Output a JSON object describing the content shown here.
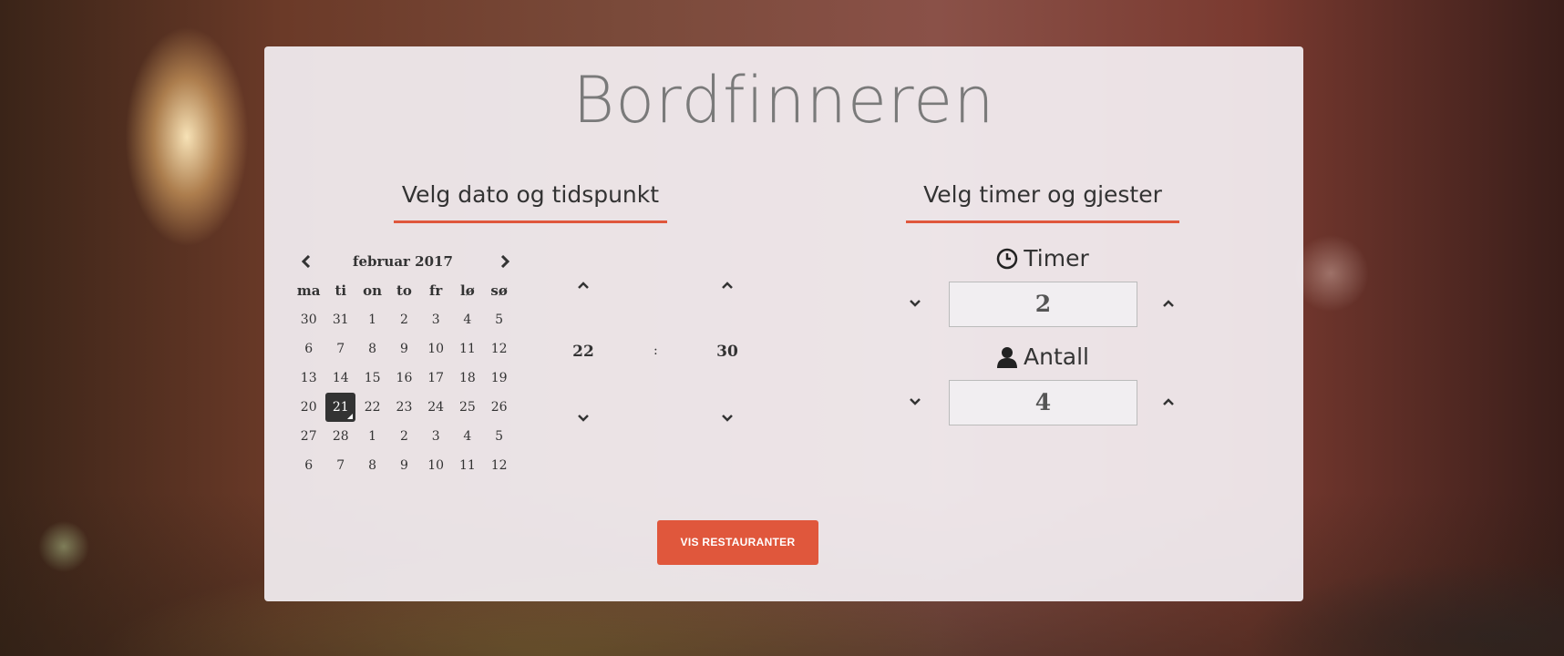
{
  "app": {
    "title": "Bordfinneren"
  },
  "left_section": {
    "heading": "Velg dato og tidspunkt"
  },
  "right_section": {
    "heading": "Velg timer og gjester"
  },
  "calendar": {
    "month_label": "februar 2017",
    "weekdays": [
      "ma",
      "ti",
      "on",
      "to",
      "fr",
      "lø",
      "sø"
    ],
    "weeks": [
      [
        "30",
        "31",
        "1",
        "2",
        "3",
        "4",
        "5"
      ],
      [
        "6",
        "7",
        "8",
        "9",
        "10",
        "11",
        "12"
      ],
      [
        "13",
        "14",
        "15",
        "16",
        "17",
        "18",
        "19"
      ],
      [
        "20",
        "21",
        "22",
        "23",
        "24",
        "25",
        "26"
      ],
      [
        "27",
        "28",
        "1",
        "2",
        "3",
        "4",
        "5"
      ],
      [
        "6",
        "7",
        "8",
        "9",
        "10",
        "11",
        "12"
      ]
    ],
    "selected_day": "21"
  },
  "time": {
    "hour": "22",
    "separator": ":",
    "minute": "30"
  },
  "hours_counter": {
    "label": "Timer",
    "icon": "clock-icon",
    "value": "2"
  },
  "guests_counter": {
    "label": "Antall",
    "icon": "person-icon",
    "value": "4"
  },
  "submit": {
    "label": "VIS RESTAURANTER"
  },
  "colors": {
    "accent": "#e0573c",
    "selected_bg": "#333333"
  }
}
